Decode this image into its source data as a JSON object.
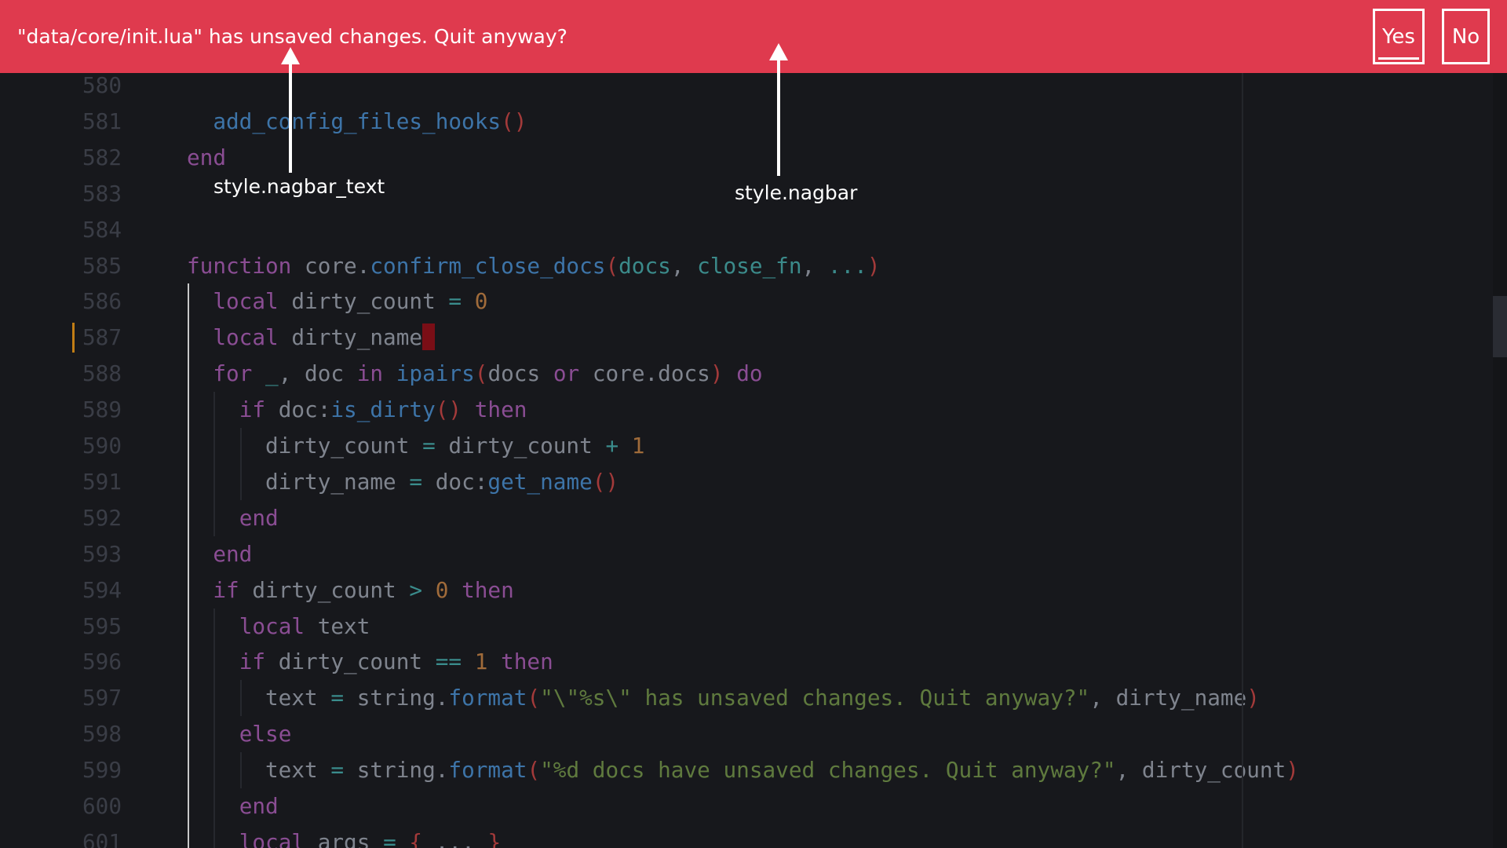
{
  "nagbar": {
    "message": "\"data/core/init.lua\" has unsaved changes. Quit anyway?",
    "yes_label": "Yes",
    "no_label": "No",
    "color": "#df3a4e"
  },
  "annotations": {
    "nagbar_text": "style.nagbar_text",
    "nagbar": "style.nagbar"
  },
  "editor": {
    "background": "#17181c",
    "cursor_line": 587,
    "active_block": [
      586,
      601
    ],
    "lines": [
      {
        "num": "580",
        "tokens": []
      },
      {
        "num": "581",
        "tokens": [
          [
            "n",
            "  "
          ],
          [
            "f",
            "add_config_files_hooks"
          ],
          [
            "p",
            "()"
          ]
        ]
      },
      {
        "num": "582",
        "tokens": [
          [
            "k",
            "end"
          ]
        ]
      },
      {
        "num": "583",
        "tokens": []
      },
      {
        "num": "584",
        "tokens": []
      },
      {
        "num": "585",
        "tokens": [
          [
            "k",
            "function"
          ],
          [
            "n",
            " core."
          ],
          [
            "f",
            "confirm_close_docs"
          ],
          [
            "p",
            "("
          ],
          [
            "prm",
            "docs"
          ],
          [
            "n",
            ", "
          ],
          [
            "prm",
            "close_fn"
          ],
          [
            "n",
            ", "
          ],
          [
            "prm",
            "..."
          ],
          [
            "p",
            ")"
          ]
        ]
      },
      {
        "num": "586",
        "tokens": [
          [
            "n",
            "  "
          ],
          [
            "k",
            "local"
          ],
          [
            "n",
            " dirty_count "
          ],
          [
            "o",
            "="
          ],
          [
            "n",
            " "
          ],
          [
            "num",
            "0"
          ]
        ]
      },
      {
        "num": "587",
        "tokens": [
          [
            "n",
            "  "
          ],
          [
            "k",
            "local"
          ],
          [
            "n",
            " dirty_name"
          ]
        ]
      },
      {
        "num": "588",
        "tokens": [
          [
            "n",
            "  "
          ],
          [
            "k",
            "for"
          ],
          [
            "n",
            " "
          ],
          [
            "o",
            "_"
          ],
          [
            "n",
            ", doc "
          ],
          [
            "k",
            "in"
          ],
          [
            "n",
            " "
          ],
          [
            "f",
            "ipairs"
          ],
          [
            "p",
            "("
          ],
          [
            "n",
            "docs "
          ],
          [
            "k",
            "or"
          ],
          [
            "n",
            " core.docs"
          ],
          [
            "p",
            ")"
          ],
          [
            "n",
            " "
          ],
          [
            "k",
            "do"
          ]
        ]
      },
      {
        "num": "589",
        "tokens": [
          [
            "n",
            "    "
          ],
          [
            "k",
            "if"
          ],
          [
            "n",
            " doc:"
          ],
          [
            "f",
            "is_dirty"
          ],
          [
            "p",
            "()"
          ],
          [
            "n",
            " "
          ],
          [
            "k",
            "then"
          ]
        ]
      },
      {
        "num": "590",
        "tokens": [
          [
            "n",
            "      dirty_count "
          ],
          [
            "o",
            "="
          ],
          [
            "n",
            " dirty_count "
          ],
          [
            "o",
            "+"
          ],
          [
            "n",
            " "
          ],
          [
            "num",
            "1"
          ]
        ]
      },
      {
        "num": "591",
        "tokens": [
          [
            "n",
            "      dirty_name "
          ],
          [
            "o",
            "="
          ],
          [
            "n",
            " doc:"
          ],
          [
            "f",
            "get_name"
          ],
          [
            "p",
            "()"
          ]
        ]
      },
      {
        "num": "592",
        "tokens": [
          [
            "n",
            "    "
          ],
          [
            "k",
            "end"
          ]
        ]
      },
      {
        "num": "593",
        "tokens": [
          [
            "n",
            "  "
          ],
          [
            "k",
            "end"
          ]
        ]
      },
      {
        "num": "594",
        "tokens": [
          [
            "n",
            "  "
          ],
          [
            "k",
            "if"
          ],
          [
            "n",
            " dirty_count "
          ],
          [
            "o",
            ">"
          ],
          [
            "n",
            " "
          ],
          [
            "num",
            "0"
          ],
          [
            "n",
            " "
          ],
          [
            "k",
            "then"
          ]
        ]
      },
      {
        "num": "595",
        "tokens": [
          [
            "n",
            "    "
          ],
          [
            "k",
            "local"
          ],
          [
            "n",
            " text"
          ]
        ]
      },
      {
        "num": "596",
        "tokens": [
          [
            "n",
            "    "
          ],
          [
            "k",
            "if"
          ],
          [
            "n",
            " dirty_count "
          ],
          [
            "o",
            "=="
          ],
          [
            "n",
            " "
          ],
          [
            "num",
            "1"
          ],
          [
            "n",
            " "
          ],
          [
            "k",
            "then"
          ]
        ]
      },
      {
        "num": "597",
        "tokens": [
          [
            "n",
            "      text "
          ],
          [
            "o",
            "="
          ],
          [
            "n",
            " string."
          ],
          [
            "f",
            "format"
          ],
          [
            "p",
            "("
          ],
          [
            "s",
            "\"\\\"%s\\\" has unsaved changes. Quit anyway?\""
          ],
          [
            "n",
            ", dirty_name"
          ],
          [
            "p",
            ")"
          ]
        ]
      },
      {
        "num": "598",
        "tokens": [
          [
            "n",
            "    "
          ],
          [
            "k",
            "else"
          ]
        ]
      },
      {
        "num": "599",
        "tokens": [
          [
            "n",
            "      text "
          ],
          [
            "o",
            "="
          ],
          [
            "n",
            " string."
          ],
          [
            "f",
            "format"
          ],
          [
            "p",
            "("
          ],
          [
            "s",
            "\"%d docs have unsaved changes. Quit anyway?\""
          ],
          [
            "n",
            ", dirty_count"
          ],
          [
            "p",
            ")"
          ]
        ]
      },
      {
        "num": "600",
        "tokens": [
          [
            "n",
            "    "
          ],
          [
            "k",
            "end"
          ]
        ]
      },
      {
        "num": "601",
        "tokens": [
          [
            "n",
            "    "
          ],
          [
            "k",
            "local"
          ],
          [
            "n",
            " args "
          ],
          [
            "o",
            "="
          ],
          [
            "n",
            " "
          ],
          [
            "p",
            "{"
          ],
          [
            "n",
            " ... "
          ],
          [
            "p",
            "}"
          ]
        ]
      }
    ]
  }
}
